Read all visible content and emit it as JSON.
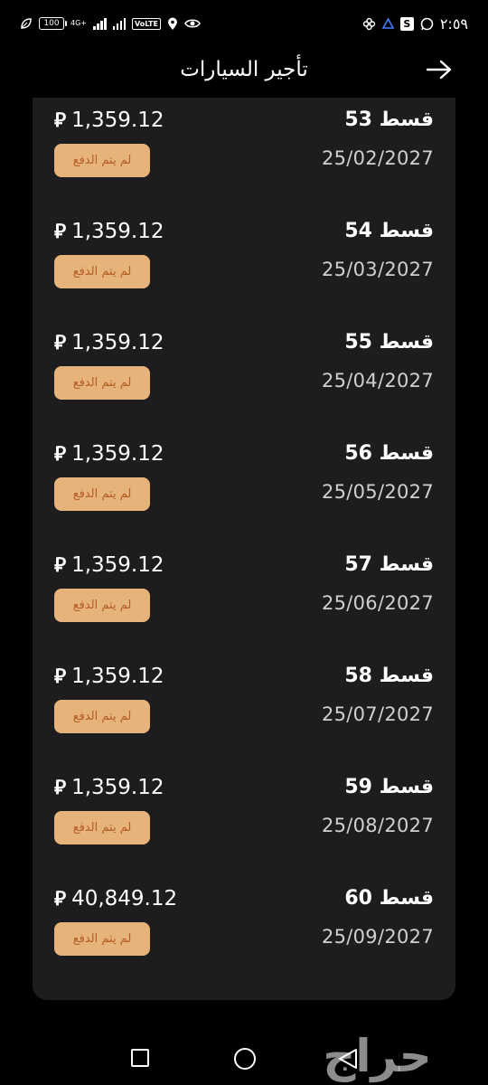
{
  "status_bar": {
    "time": "٢:٥٩",
    "battery": "100",
    "network": "4G+",
    "volte": "VoLTE",
    "icons": [
      "leaf-icon",
      "battery-icon",
      "signal-icon",
      "signal-icon",
      "volte-icon",
      "location-icon",
      "eye-icon",
      "whatsapp-icon",
      "s-app-icon",
      "recycle-icon",
      "pinwheel-icon"
    ]
  },
  "header": {
    "title": "تأجير السيارات",
    "back_icon": "arrow-right-icon"
  },
  "installments": [
    {
      "name": "قسط 53",
      "date": "25/02/2027",
      "amount": "1,359.12",
      "status": "لم يتم الدفع"
    },
    {
      "name": "قسط 54",
      "date": "25/03/2027",
      "amount": "1,359.12",
      "status": "لم يتم الدفع"
    },
    {
      "name": "قسط 55",
      "date": "25/04/2027",
      "amount": "1,359.12",
      "status": "لم يتم الدفع"
    },
    {
      "name": "قسط 56",
      "date": "25/05/2027",
      "amount": "1,359.12",
      "status": "لم يتم الدفع"
    },
    {
      "name": "قسط 57",
      "date": "25/06/2027",
      "amount": "1,359.12",
      "status": "لم يتم الدفع"
    },
    {
      "name": "قسط 58",
      "date": "25/07/2027",
      "amount": "1,359.12",
      "status": "لم يتم الدفع"
    },
    {
      "name": "قسط 59",
      "date": "25/08/2027",
      "amount": "1,359.12",
      "status": "لم يتم الدفع"
    },
    {
      "name": "قسط 60",
      "date": "25/09/2027",
      "amount": "40,849.12",
      "status": "لم يتم الدفع"
    }
  ],
  "currency_symbol": "⃁",
  "colors": {
    "background": "#000000",
    "card": "#1d1d1f",
    "pill_bg": "#e6b37b",
    "pill_text": "#b45d22"
  },
  "watermark": "حراج"
}
